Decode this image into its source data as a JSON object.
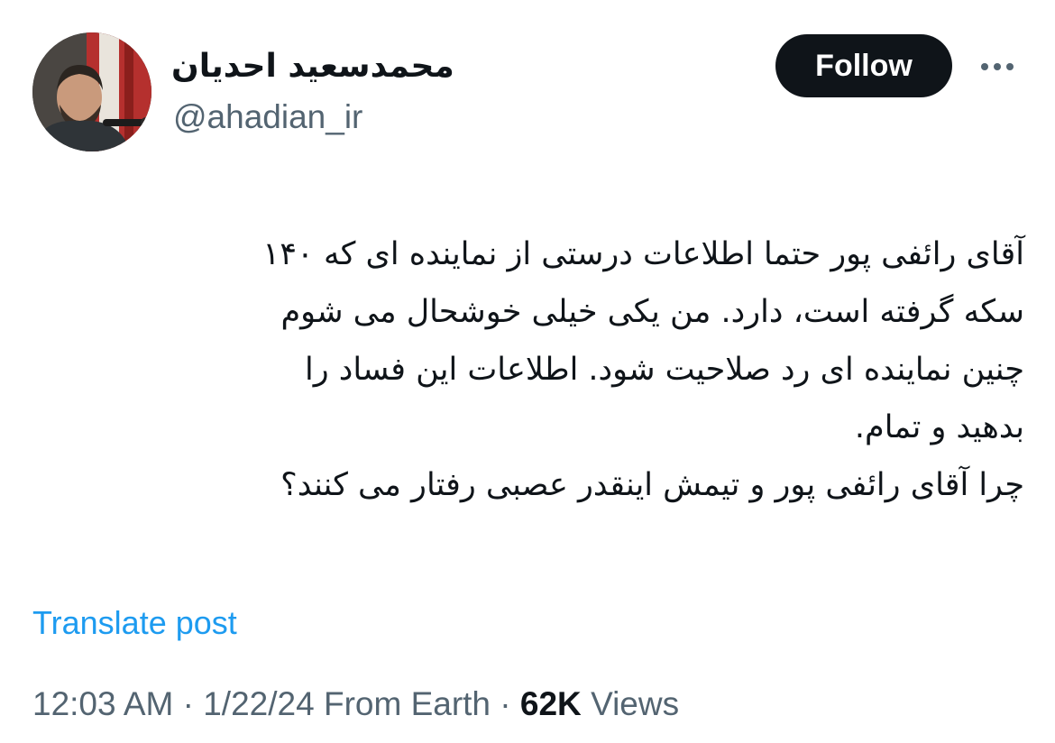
{
  "author": {
    "display_name": "محمدسعید احدیان",
    "handle": "@ahadian_ir"
  },
  "actions": {
    "follow_label": "Follow",
    "more_icon": "more-horizontal-icon"
  },
  "tweet": {
    "lines": [
      "آقای رائفی پور حتما اطلاعات درستی از نماینده ای که ۱۴۰",
      "سکه گرفته است، دارد. من یکی خیلی خوشحال می شوم",
      "چنین نماینده ای رد صلاحیت شود. اطلاعات این فساد را",
      "بدهید و تمام.",
      "چرا آقای رائفی پور و تیمش اینقدر عصبی رفتار می کنند؟"
    ]
  },
  "translate": {
    "label": "Translate post"
  },
  "meta": {
    "time": "12:03 AM",
    "sep1": " · ",
    "date": "1/22/24",
    "source": " From Earth",
    "sep2": " · ",
    "views_count": "62K",
    "views_label": " Views"
  },
  "colors": {
    "text": "#0f1419",
    "secondary": "#536471",
    "link": "#1d9bf0",
    "button_bg": "#0f1419"
  }
}
